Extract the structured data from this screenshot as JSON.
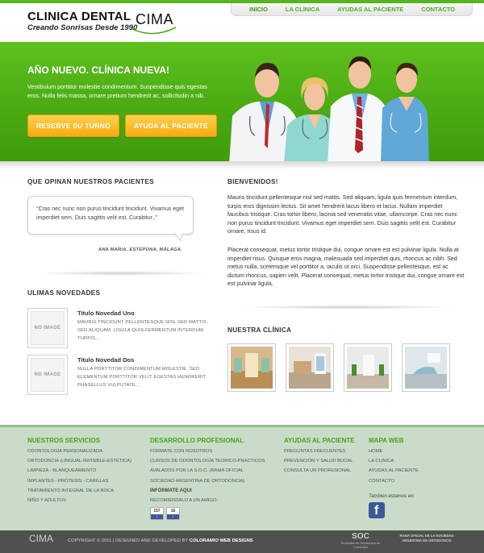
{
  "header": {
    "logo_title": "CLINICA DENTAL",
    "logo_subtitle": "Creando Sonrisas Desde 1990",
    "logo_mark": "CIMA"
  },
  "nav": {
    "items": [
      {
        "label": "INICIO",
        "active": true
      },
      {
        "label": "LA CLINICA",
        "active": false
      },
      {
        "label": "AYUDAS AL PACIENTE",
        "active": false
      },
      {
        "label": "CONTACTO",
        "active": false
      }
    ]
  },
  "hero": {
    "title": "AÑO NUEVO. CLÍNICA NUEVA!",
    "text": "Vestibulum porttitor molestie condimentum. Suspendisse quis egestas eros. Nulla felis massa, ornare pretium hendrerit ac, sollicitudin a nib.",
    "button_reserve": "RESERVE SU TURNO",
    "button_help": "AYUDA AL PACIENTE"
  },
  "testimonials": {
    "title": "QUE OPINAN NUESTROS PACIENTES",
    "quote": "\"Cras nec nunc non purus tincidunt tincidunt. Vivamus eget imperdiet sem. Duis sagittis velit est. Curabitur..\"",
    "author_name": "ANA MARIA.",
    "author_place": "ESTEPONA, MÁLAGA."
  },
  "news": {
    "title": "ULIMAS NOVEDADES",
    "thumb_label": "NO IMAGE",
    "items": [
      {
        "title": "Titulo Novedad Uno",
        "text": "MAURIS TINCIDUNT PELLENTESQUE NISL SED MATTIS. SED ALIQUAM, LIGULA QUIS FERMENTUM INTERDUM, TURPIS..."
      },
      {
        "title": "Titulo Novedad Dos",
        "text": "NULLA PORTTITOR CONDIMENTUM MOLESTIE. SED ELEMENTUM PORTTITOR VELIT EGESTAS HENDRERIT. PHASELLUS VULPUTATE..."
      }
    ]
  },
  "welcome": {
    "title": "BIENVENIDOS!",
    "paragraph1": "Mauris tincidunt pellentesque nisl sed mattis. Sed aliquam, ligula quis fermentum interdum, turpis eros dignissim lectus. Sit amet hendrerit lacus libero et lacus. Nullam imperdiet faucibus tristique. Cras tortor libero, lacinia sed venenatis vitae, ullamcorpe. Cras nec nunc non purus tincidunt tincidunt. Vivamus eget imperdiet sem. Duis sagittis velit est. Curabitur ornare, risus id.",
    "paragraph2": "Placerat consequat, metus tortor tristique dui, congue ornare est est pulvinar ligula. Nulla at imperdiet risus. Quisque eros magna, malesuada sed imperdiet quis, rhoncus ac nibh. Sed metus nulla, scelerisque vel porttitor a, iaculis ut orci. Suspendisse pellentesque, est ac dictum rhoncus, sapien velit. Placerat consequat, metus tortor tristique dui, congue ornare est est pulvinar ligula."
  },
  "clinic": {
    "title": "NUESTRA CLÍNICA"
  },
  "footer": {
    "services": {
      "title": "NUESTROS SERVICIOS",
      "links": [
        "ODONTOLOGÍA PERSONALIZADA",
        "ORTODONCIA (LINGUAL-INVISIBLE-ESTÉTICA)",
        "LIMPIEZA - BLANQUEAMIENTO",
        "IMPLANTES - PRÓTESIS - CARILLAS",
        "TRATAMIENTO INTEGRAL DE LA BOCA",
        "NIÑO Y ADULTOS"
      ]
    },
    "development": {
      "title": "DESARROLLO PROFESIONAL",
      "links": [
        "FORMATE CON NOSOTROS",
        "CURSOS DE ODONTOLOGÍA TEORICO-PRACTICOS",
        "AVALADOS POR LA S.O.C. (RAMA OFICIAL",
        "SOCIEDAD ARGENTINA DE ORTODONCIA)"
      ],
      "info_label": "INFÓRMATE AQUI",
      "recommend": "RECOMIÉNDALO A UN AMIGO:",
      "share_count": "157",
      "like_count": "16"
    },
    "help": {
      "title": "AYUDAS AL PACIENTE",
      "links": [
        "PREGUNTAS FRECUENTES",
        "PREVENCIÓN Y SALUD BUCAL",
        "CONSULTA UN PROFESIONAL"
      ]
    },
    "sitemap": {
      "title": "MAPA WEB",
      "links": [
        "HOME",
        "LA CLINICA",
        "AYUDAS AL PACIENTE",
        "CONTACTO"
      ],
      "follow": "Tambien estamos en:"
    }
  },
  "bottom": {
    "logo": "CIMA",
    "copyright": "COPYRIGHT © 2011 | DESIGNED AND DEVELOPED BY",
    "designer": "COLORAMIO WEB DESIGNS",
    "soc_big": "SOC",
    "soc_small": "Sociedad de Ortodoncia de Corrientes",
    "rama": "RAMA OFICIAL DE LA SOCIEDAD ARGENTINA DE ORTODONCIA"
  },
  "colors": {
    "brand_green": "#4aab12",
    "accent_orange": "#f7a912",
    "footer_bg": "#c9dcc9"
  }
}
